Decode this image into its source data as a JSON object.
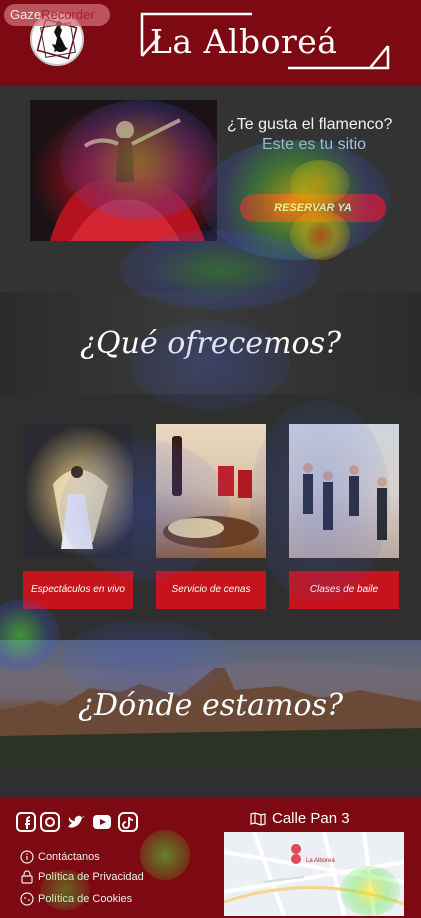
{
  "recorder_badge": {
    "part1": "Gaze",
    "part2": "Recorder"
  },
  "header": {
    "brand": "La Alboreá"
  },
  "hero": {
    "question": "¿Te gusta el flamenco?",
    "subtitle": "Este es tu sitio",
    "cta": "RESERVAR YA"
  },
  "offers": {
    "title": "¿Qué ofrecemos?",
    "items": [
      {
        "label": "Espectáculos en vivo"
      },
      {
        "label": "Servicio de cenas"
      },
      {
        "label": "Clases de baile"
      }
    ]
  },
  "location": {
    "title": "¿Dónde estamos?"
  },
  "footer": {
    "address": "Calle Pan 3",
    "links": [
      {
        "label": "Contáctanos",
        "icon": "info-icon"
      },
      {
        "label": "Política de Privacidad",
        "icon": "lock-icon"
      },
      {
        "label": "Política de Cookies",
        "icon": "cookie-icon"
      }
    ],
    "social": [
      "facebook-icon",
      "instagram-icon",
      "twitter-icon",
      "youtube-icon",
      "tiktok-icon"
    ],
    "map_label": "La Alboreá"
  },
  "colors": {
    "brand_red": "#7d0a12",
    "button_red": "#c5141c",
    "background": "#2e2e2e"
  }
}
